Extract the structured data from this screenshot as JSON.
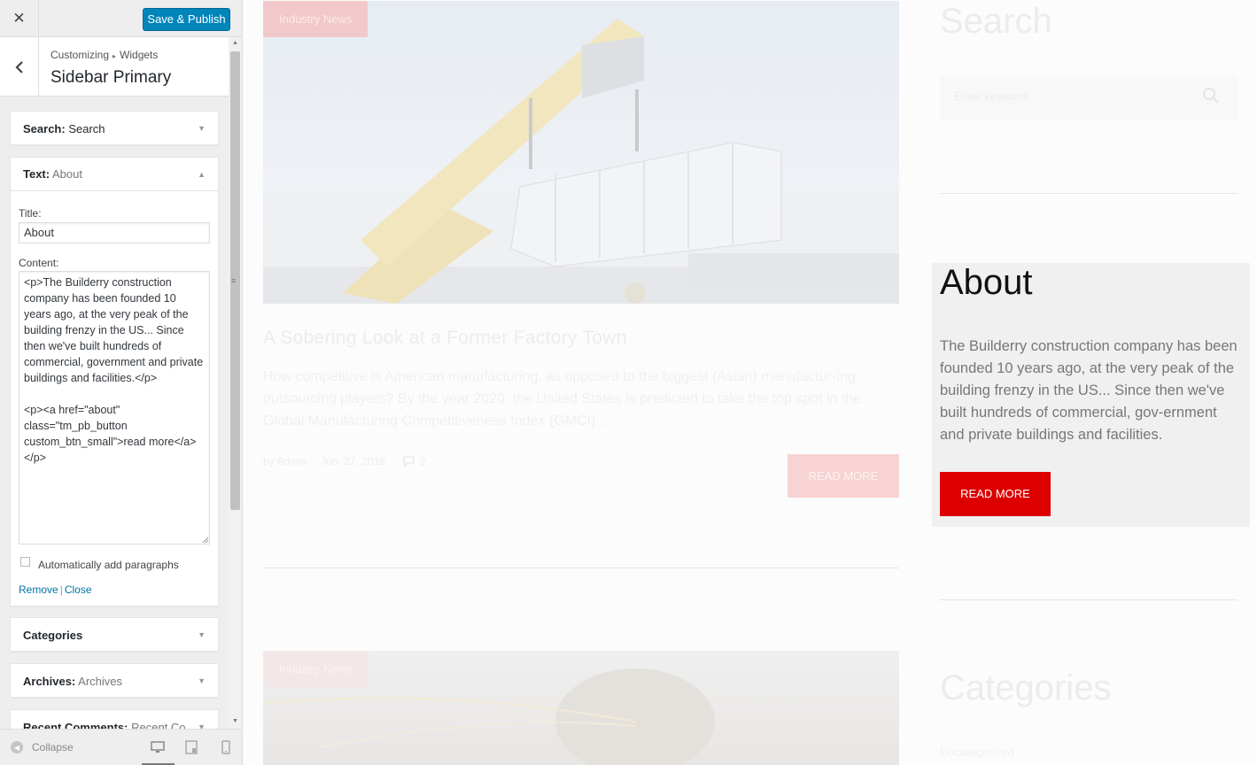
{
  "customizer": {
    "close_icon": "close-icon",
    "save_label": "Save & Publish",
    "breadcrumb": {
      "parent": "Customizing",
      "current": "Widgets"
    },
    "section_title": "Sidebar Primary",
    "widgets": {
      "search": {
        "type": "Search:",
        "name": "Search"
      },
      "text": {
        "type": "Text:",
        "name": "About",
        "title_label": "Title:",
        "title_value": "About",
        "content_label": "Content:",
        "content_value": "<p>The Builderry construction company has been founded 10 years ago, at the very peak of the building frenzy in the US... Since then we've built hundreds of commercial, government and private buildings and facilities.</p>\n\n<p><a href=\"about\" class=\"tm_pb_button custom_btn_small\">read more</a></p>",
        "autop_label": "Automatically add paragraphs",
        "autop_checked": false,
        "remove_label": "Remove",
        "close_label": "Close"
      },
      "categories": {
        "type": "Categories",
        "name": ""
      },
      "archives": {
        "type": "Archives:",
        "name": "Archives"
      },
      "recent_comments": {
        "type": "Recent Comments:",
        "name": "Recent Co..."
      }
    },
    "footer": {
      "collapse_label": "Collapse"
    }
  },
  "preview": {
    "post1": {
      "tag": "Industry News",
      "title": "A Sobering Look at a Former Factory Town",
      "excerpt": "How competitive is American manufacturing, as opposed to the biggest (Asian) manufactur-ing outsourcing players? By the year 2020, the United States is predicted to take the top spot in the Global Manufacturing Competitiveness Index (GMCI)...",
      "meta_by": "by Admin",
      "meta_date": "Jun. 27, 2016",
      "meta_comments": "2",
      "read_more": "READ MORE"
    },
    "post2": {
      "tag": "Industry News"
    },
    "sidebar": {
      "search_title": "Search",
      "search_placeholder": "Enter keyword",
      "about_title": "About",
      "about_text": "The Builderry construction company has been founded 10 years ago, at the very peak of the building frenzy in the US... Since then we've built hundreds of commercial, gov-ernment and private buildings and facilities.",
      "about_button": "READ MORE",
      "categories_title": "Categories",
      "categories_item": "Uncategorized"
    }
  },
  "colors": {
    "wp_blue": "#0085ba",
    "accent_red": "#dd0000",
    "link_blue": "#0073aa"
  }
}
